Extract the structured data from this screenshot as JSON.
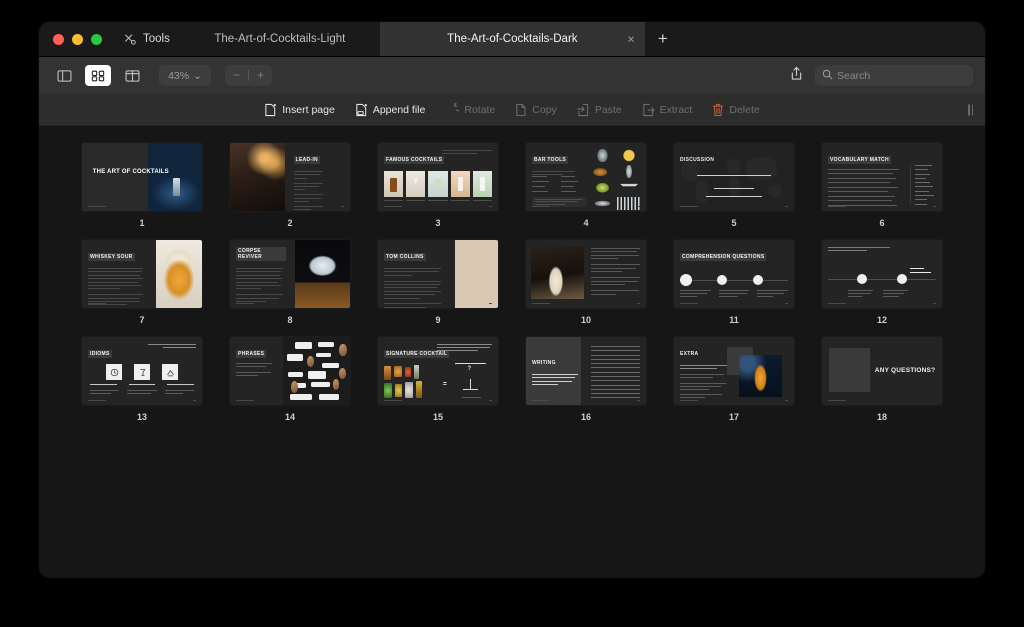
{
  "window": {
    "tools_label": "Tools",
    "tools_icon": "tools-icon",
    "traffic": [
      "close-button",
      "minimize-button",
      "maximize-button"
    ]
  },
  "tabs": [
    {
      "label": "The-Art-of-Cocktails-Light",
      "active": false
    },
    {
      "label": "The-Art-of-Cocktails-Dark",
      "active": true,
      "close_glyph": "×"
    }
  ],
  "new_tab_glyph": "+",
  "toolbar": {
    "view_sidebar": "sidebar-view-button",
    "view_grid": "grid-view-button",
    "view_twopage": "two-page-view-button",
    "zoom_value": "43%",
    "zoom_chevron": "⌄",
    "zoom_out": "−",
    "zoom_sep": "|",
    "zoom_in": "+",
    "share_icon": "share-icon",
    "search": {
      "placeholder": "Search",
      "value": "",
      "icon": "search-icon"
    }
  },
  "actions": [
    {
      "label": "Insert page",
      "icon": "insert-page-icon",
      "disabled": false
    },
    {
      "label": "Append file",
      "icon": "append-file-icon",
      "disabled": false
    },
    {
      "label": "Rotate",
      "icon": "rotate-icon",
      "disabled": true
    },
    {
      "label": "Copy",
      "icon": "copy-icon",
      "disabled": true
    },
    {
      "label": "Paste",
      "icon": "paste-icon",
      "disabled": true
    },
    {
      "label": "Extract",
      "icon": "extract-icon",
      "disabled": true
    },
    {
      "label": "Delete",
      "icon": "delete-icon",
      "disabled": true
    }
  ],
  "pages": [
    {
      "number": "1",
      "title": "THE ART OF COCKTAILS",
      "layout": "title"
    },
    {
      "number": "2",
      "title": "LEAD-IN",
      "layout": "image-left-list-right"
    },
    {
      "number": "3",
      "title": "FAMOUS COCKTAILS",
      "subtitle": "Describe each cocktail used to its place in time",
      "layout": "cocktail-cards"
    },
    {
      "number": "4",
      "title": "BAR TOOLS",
      "subtitle": "Match words with pictures and describe what each tool is used for.",
      "layout": "bar-tools"
    },
    {
      "number": "5",
      "title": "DISCUSSION",
      "layout": "discussion",
      "questions": [
        "What's the most popular alcoholic beverage in your country?",
        "What is it made of?",
        "What do you know about its history?"
      ]
    },
    {
      "number": "6",
      "title": "VOCABULARY MATCH",
      "layout": "vocab-match"
    },
    {
      "number": "7",
      "title": "WHISKEY SOUR",
      "layout": "recipe-right-photo"
    },
    {
      "number": "8",
      "title": "CORPSE REVIVER",
      "layout": "recipe-right-photo"
    },
    {
      "number": "9",
      "title": "TOM COLLINS",
      "layout": "recipe-right-photo"
    },
    {
      "number": "10",
      "title": "",
      "layout": "photo-left-text-right"
    },
    {
      "number": "11",
      "title": "COMPREHENSION QUESTIONS",
      "layout": "timeline-3"
    },
    {
      "number": "12",
      "title": "",
      "layout": "timeline-2",
      "end_label": "Your Question"
    },
    {
      "number": "13",
      "title": "IDIOMS",
      "subtitle": "Read the idioms and match each one to the context they it relates to",
      "layout": "idiom-cards",
      "cards": [
        "Get in Drinks",
        "Wines With Dinner",
        "Top of the Bag"
      ]
    },
    {
      "number": "14",
      "title": "PHRASES",
      "layout": "phrases"
    },
    {
      "number": "15",
      "title": "SIGNATURE COCKTAIL",
      "subtitle": "Imagine you have our 10 ingredients in your fridge. Now, craft a delightful cocktail using them as you like. Give your cocktail a name. Be creative and have fun!",
      "layout": "signature",
      "equals": "=",
      "glass_mark": "?"
    },
    {
      "number": "16",
      "title": "WRITING",
      "layout": "writing"
    },
    {
      "number": "17",
      "title": "EXTRA",
      "layout": "extra"
    },
    {
      "number": "18",
      "title": "ANY QUESTIONS?",
      "layout": "closing"
    }
  ],
  "colors": {
    "window_bg": "#1e1e1e",
    "toolbar_bg": "#333333",
    "actionbar_bg": "#2d2d2d",
    "content_bg": "#161616",
    "slide_bg": "#242424",
    "accent_delete": "#c0603a",
    "tab_active_bg": "#323232"
  }
}
